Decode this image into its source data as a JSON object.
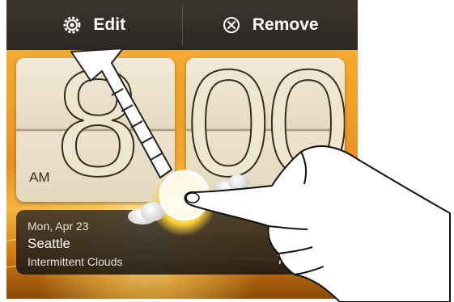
{
  "toolbar": {
    "edit_label": "Edit",
    "remove_label": "Remove",
    "edit_icon": "gear-icon",
    "remove_icon": "close-circle-icon"
  },
  "clock": {
    "hour": "8",
    "minutes": "00",
    "period": "AM"
  },
  "weather": {
    "date": "Mon, Apr 23",
    "city": "Seattle",
    "condition": "Intermittent Clouds",
    "temperature": "75",
    "icon": "sun-with-clouds-icon"
  },
  "gesture": {
    "icon": "pointing-hand-icon",
    "direction": "drag-up-to-edit"
  },
  "colors": {
    "background": "#f0a12a",
    "toolbar": "#2c2722",
    "card": "#e5dac2"
  }
}
